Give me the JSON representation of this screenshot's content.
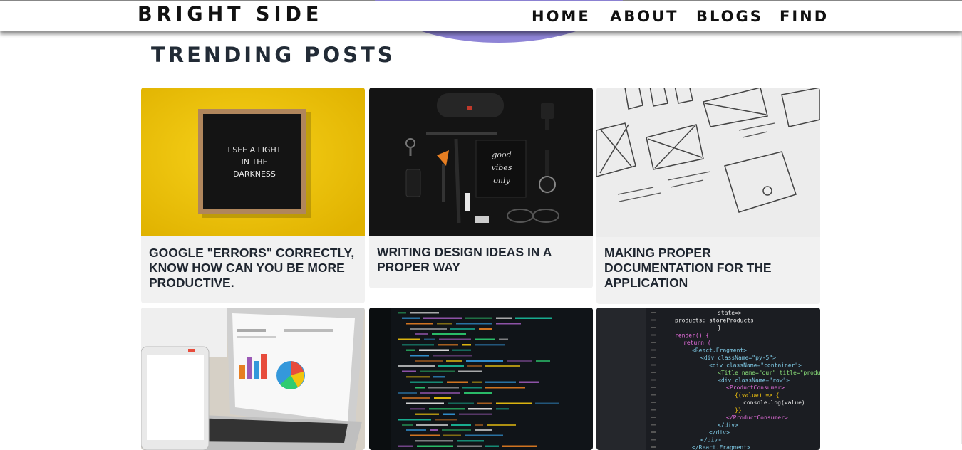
{
  "header": {
    "brand": "BRIGHT SIDE",
    "nav": [
      "HOME",
      "ABOUT",
      "BLOGS",
      "FIND"
    ]
  },
  "section": {
    "title": "TRENDING POSTS"
  },
  "posts": [
    {
      "title": "GOOGLE \"ERRORS\" CORRECTLY, KNOW HOW CAN YOU BE MORE PRODUCTIVE.",
      "image": "letter-board-photo"
    },
    {
      "title": "WRITING DESIGN IDEAS IN A PROPER WAY",
      "image": "flat-lay-desk-photo"
    },
    {
      "title": "MAKING PROPER DOCUMENTATION FOR THE APPLICATION",
      "image": "wireframe-sketch-photo"
    },
    {
      "title": "",
      "image": "laptop-charts-photo"
    },
    {
      "title": "",
      "image": "code-screen-photo"
    },
    {
      "title": "",
      "image": "react-code-photo"
    }
  ],
  "letter_board": {
    "lines": [
      "I SEE A LIGHT",
      "IN THE",
      "DARKNESS"
    ]
  },
  "notebook": {
    "lines": [
      "good",
      "vibes",
      "only"
    ]
  },
  "react_code": {
    "lines": [
      "state=>",
      "products: storeProducts",
      "}",
      "render() {",
      "return (",
      "<React.Fragment>",
      "<div className=\"py-5\">",
      "<div className=\"container\">",
      "<Title name=\"our\" title=\"product",
      "<div className=\"row\">",
      "<ProductConsumer>",
      "{(value) => {",
      "console.log(value)",
      "}}",
      "</ProductConsumer>",
      "</div>",
      "</div>",
      "</div>",
      "</React.Fragment>"
    ]
  },
  "colors": {
    "yellow": "#f2c500",
    "dark": "#141414",
    "card": "#f1f1f1",
    "accent_blob": "#8e84d6"
  }
}
